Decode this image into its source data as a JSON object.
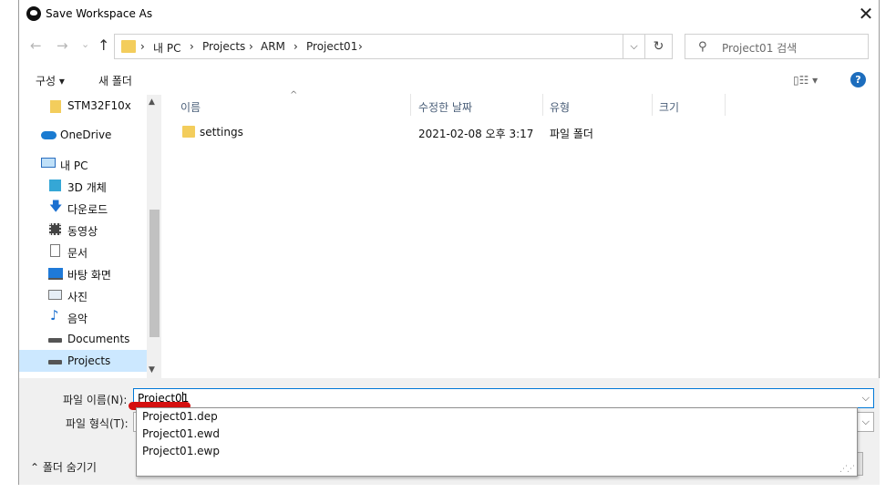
{
  "window": {
    "title": "Save Workspace As",
    "close": "✕"
  },
  "nav": {
    "back": "←",
    "forward": "→",
    "history": "⌄",
    "up": "↑",
    "breadcrumb": [
      "내 PC",
      "Projects",
      "ARM",
      "Project01"
    ],
    "sep": "›",
    "dropdown": "⌵",
    "refresh": "↻",
    "search_placeholder": "Project01 검색",
    "search_icon": "⚲"
  },
  "toolbar": {
    "organize": "구성 ▾",
    "new_folder": "새 폴더",
    "view": "▯☷ ▾",
    "help": "?"
  },
  "sidebar": {
    "items": [
      {
        "label": "STM32F10x",
        "icon": "folder-icon"
      },
      {
        "label": "OneDrive",
        "icon": "cloud-icon"
      },
      {
        "label": "내 PC",
        "icon": "pc-icon"
      },
      {
        "label": "3D 개체",
        "icon": "cube-icon"
      },
      {
        "label": "다운로드",
        "icon": "download-icon"
      },
      {
        "label": "동영상",
        "icon": "video-icon"
      },
      {
        "label": "문서",
        "icon": "document-icon"
      },
      {
        "label": "바탕 화면",
        "icon": "desktop-icon"
      },
      {
        "label": "사진",
        "icon": "picture-icon"
      },
      {
        "label": "음악",
        "icon": "music-icon"
      },
      {
        "label": "Documents",
        "icon": "drive-icon"
      },
      {
        "label": "Projects",
        "icon": "drive-icon"
      }
    ],
    "selected": "Projects"
  },
  "columns": {
    "name": "이름",
    "date": "수정한 날짜",
    "type": "유형",
    "size": "크기",
    "sort_arrow": "^"
  },
  "files": [
    {
      "name": "settings",
      "date": "2021-02-08 오후 3:17",
      "type": "파일 폴더",
      "size": ""
    }
  ],
  "form": {
    "filename_label": "파일 이름(N):",
    "filename_value": "Project01",
    "filetype_label": "파일 형식(T):",
    "hide_folders": "⌃ 폴더 숨기기"
  },
  "autocomplete": [
    "Project01.dep",
    "Project01.ewd",
    "Project01.ewp"
  ],
  "colors": {
    "accent": "#0078d7",
    "selection": "#cce8ff",
    "folder": "#f3cd5c",
    "annotation": "#d51010"
  }
}
